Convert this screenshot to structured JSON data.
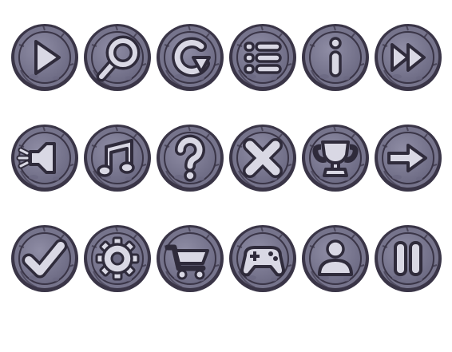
{
  "theme": {
    "stone_outer": "#3a3547",
    "stone_rim": "#76748c",
    "stone_face": "#8f8da5",
    "stone_face_dark": "#6b6982",
    "glyph_fill": "#d9d8e4",
    "glyph_stroke": "#2f2b3b"
  },
  "buttons": [
    {
      "icon": "play-icon"
    },
    {
      "icon": "search-icon"
    },
    {
      "icon": "restart-icon"
    },
    {
      "icon": "menu-list-icon"
    },
    {
      "icon": "info-icon"
    },
    {
      "icon": "fast-forward-icon"
    },
    {
      "icon": "sound-icon"
    },
    {
      "icon": "music-icon"
    },
    {
      "icon": "help-icon"
    },
    {
      "icon": "close-icon"
    },
    {
      "icon": "trophy-icon"
    },
    {
      "icon": "next-arrow-icon"
    },
    {
      "icon": "check-icon"
    },
    {
      "icon": "settings-gear-icon"
    },
    {
      "icon": "shop-cart-icon"
    },
    {
      "icon": "gamepad-icon"
    },
    {
      "icon": "profile-icon"
    },
    {
      "icon": "pause-icon"
    }
  ]
}
